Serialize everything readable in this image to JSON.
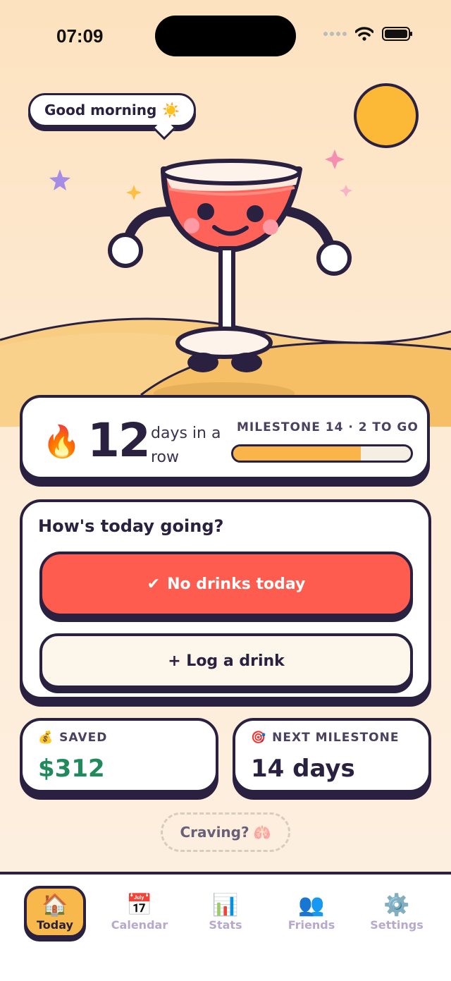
{
  "status": {
    "time": "07:09"
  },
  "hero": {
    "greeting": "Good morning",
    "greeting_emoji": "☀️"
  },
  "streak": {
    "count": "12",
    "label": "days in a row",
    "flame_emoji": "🔥",
    "milestone_label": "MILESTONE 14 · 2 TO GO",
    "progress": 0.72
  },
  "today": {
    "title": "How's today going?",
    "primary_check": "✔",
    "primary_label": "No drinks today",
    "secondary_label": "+ Log a drink"
  },
  "saved": {
    "emoji": "💰",
    "label": "SAVED",
    "value": "$312"
  },
  "next": {
    "emoji": "🎯",
    "label": "NEXT MILESTONE",
    "value": "14 days"
  },
  "craving": {
    "label": "Craving?",
    "emoji": "🫁"
  },
  "tabs": [
    {
      "label": "Today",
      "icon": "🏠"
    },
    {
      "label": "Calendar",
      "icon": "📅"
    },
    {
      "label": "Stats",
      "icon": "📊"
    },
    {
      "label": "Friends",
      "icon": "👥"
    },
    {
      "label": "Settings",
      "icon": "⚙️"
    }
  ],
  "colors": {
    "ink": "#2a2140",
    "accent": "#ff5c50",
    "sun": "#fbb937",
    "progress": "#f9b54a",
    "money": "#1f8a5b"
  }
}
